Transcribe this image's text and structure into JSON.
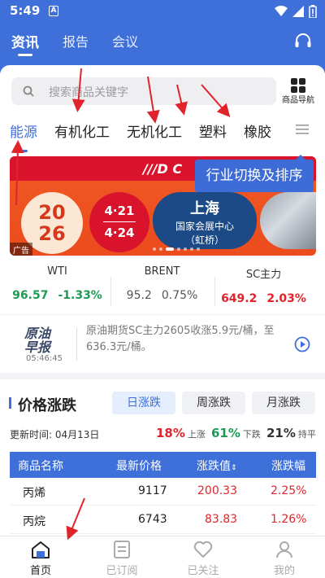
{
  "status_bar": {
    "time": "5:49",
    "notification_letter": "A"
  },
  "main_tabs": [
    {
      "label": "资讯",
      "active": true
    },
    {
      "label": "报告",
      "active": false
    },
    {
      "label": "会议",
      "active": false
    }
  ],
  "search": {
    "placeholder": "搜索商品关键字"
  },
  "goods_nav": {
    "label": "商品导航"
  },
  "categories": [
    {
      "label": "能源",
      "active": true
    },
    {
      "label": "有机化工",
      "active": false
    },
    {
      "label": "无机化工",
      "active": false
    },
    {
      "label": "塑料",
      "active": false
    },
    {
      "label": "橡胶",
      "active": false
    }
  ],
  "tooltip": {
    "text": "行业切换及排序"
  },
  "banner": {
    "logo": "///D C",
    "year_top": "20",
    "year_bottom": "26",
    "date_start": "4·21",
    "date_end": "4·24",
    "city": "上海",
    "venue": "国家会展中心",
    "venue_sub": "（虹桥）",
    "ad_label": "广告"
  },
  "prices": [
    {
      "name": "WTI",
      "value": "96.57",
      "change": "-1.33%",
      "trend": "down"
    },
    {
      "name": "BRENT",
      "value": "95.2",
      "change": "0.75%",
      "trend": "flat"
    },
    {
      "name": "SC主力",
      "value": "649.2",
      "change": "2.03%",
      "trend": "up"
    }
  ],
  "news": {
    "logo_line1": "原油",
    "logo_line2": "早报",
    "time": "05:46:45",
    "text": "原油期货SC主力2605收涨5.9元/桶，至636.3元/桶。"
  },
  "price_change": {
    "title": "价格涨跌",
    "periods": [
      {
        "label": "日涨跌",
        "active": true
      },
      {
        "label": "周涨跌",
        "active": false
      },
      {
        "label": "月涨跌",
        "active": false
      }
    ],
    "update_time": "更新时间: 04月13日",
    "stats": [
      {
        "num": "18%",
        "label": "上涨",
        "color": "#e0242b"
      },
      {
        "num": "61%",
        "label": "下跌",
        "color": "#1f9a55"
      },
      {
        "num": "21%",
        "label": "持平",
        "color": "#333333"
      }
    ],
    "columns": [
      "商品名称",
      "最新价格",
      "涨跌值",
      "涨跌幅"
    ],
    "rows": [
      {
        "name": "丙烯",
        "price": "9117",
        "change": "200.33",
        "pct": "2.25%"
      },
      {
        "name": "丙烷",
        "price": "6743",
        "change": "83.83",
        "pct": "1.26%"
      }
    ]
  },
  "bottom_nav": [
    {
      "label": "首页",
      "icon": "home-icon",
      "active": true
    },
    {
      "label": "已订阅",
      "icon": "document-icon",
      "active": false
    },
    {
      "label": "已关注",
      "icon": "heart-icon",
      "active": false
    },
    {
      "label": "我的",
      "icon": "user-icon",
      "active": false
    }
  ],
  "colors": {
    "accent": "#3f6fd8",
    "up": "#e0242b",
    "down": "#1f9a55",
    "annotation": "#e0242b"
  }
}
